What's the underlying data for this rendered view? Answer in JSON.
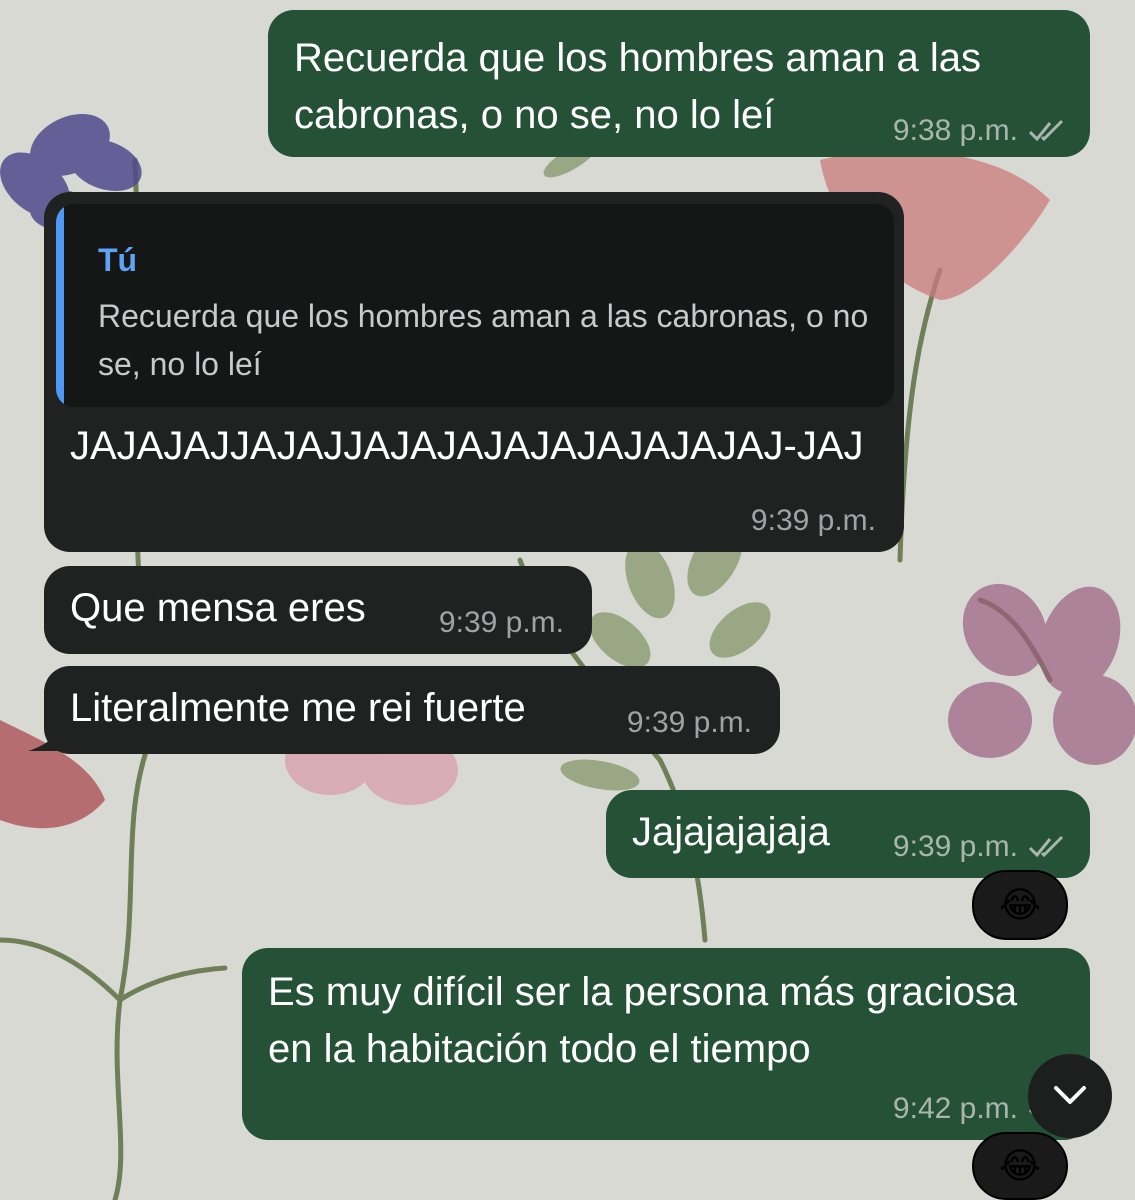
{
  "messages": [
    {
      "text": "Recuerda que los hombres aman a las cabronas, o no se, no lo leí",
      "time": "9:38 p.m."
    },
    {
      "quote_author": "Tú",
      "quote_text": "Recuerda que los hombres aman a las cabronas, o no se, no lo leí",
      "text": "JAJAJAJJAJAJJAJAJAJAJAJAJAJAJAJ-JAJ",
      "time": "9:39 p.m."
    },
    {
      "text": "Que mensa eres",
      "time": "9:39 p.m."
    },
    {
      "text": "Literalmente me rei fuerte",
      "time": "9:39 p.m."
    },
    {
      "text": "Jajajajajaja",
      "time": "9:39 p.m.",
      "reaction": "😂"
    },
    {
      "text": "Es muy difícil ser la persona más graciosa en la habitación todo el tiempo",
      "time": "9:42 p.m.",
      "reaction": "😂"
    }
  ],
  "icons": {
    "read": "double-check-icon",
    "scroll": "chevron-down-icon",
    "wallpaper": "floral-wallpaper"
  },
  "colors": {
    "outgoing": "#255137",
    "incoming": "#202222",
    "quote_bar": "#4f98f3",
    "background": "#d9d9d3"
  }
}
